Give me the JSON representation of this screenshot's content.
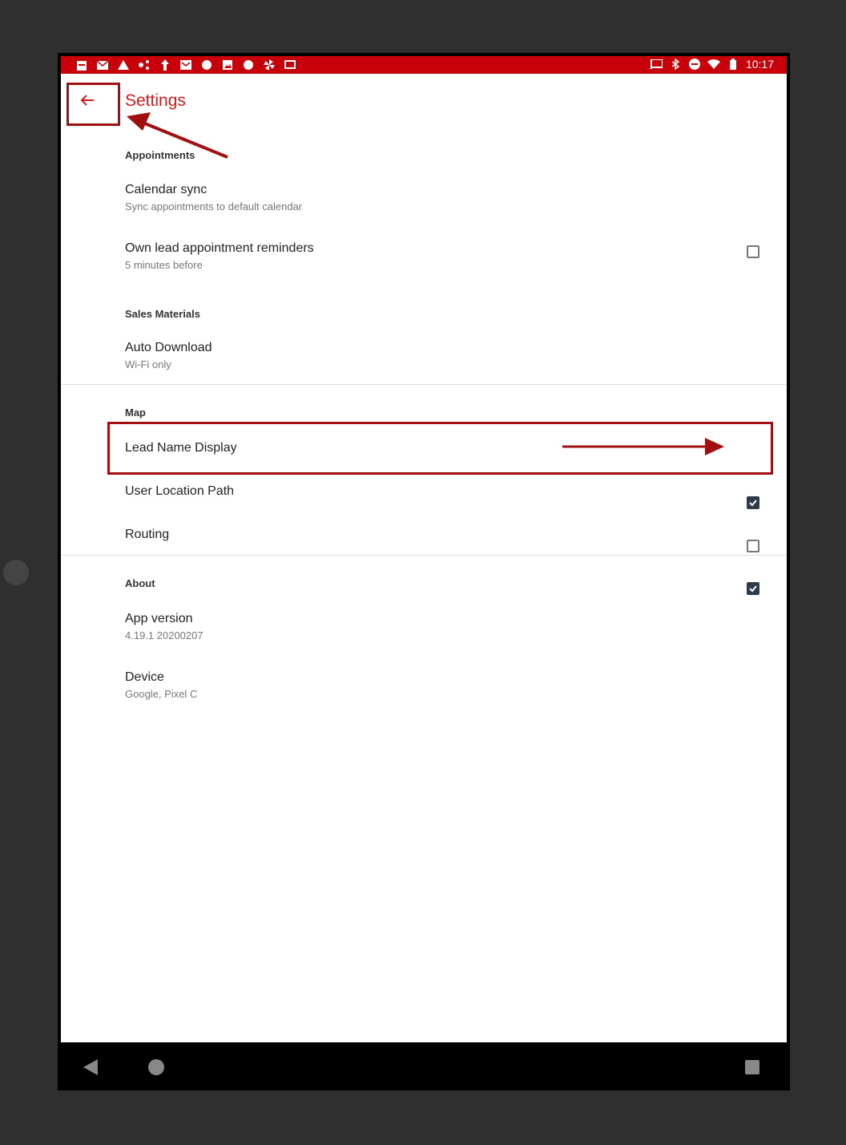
{
  "status_bar": {
    "time": "10:17"
  },
  "header": {
    "title": "Settings",
    "back_icon": "arrow-left-icon"
  },
  "sections": [
    {
      "header": "Appointments",
      "items": [
        {
          "title": "Calendar sync",
          "summary": "Sync appointments to default calendar",
          "checkbox": false
        },
        {
          "title": "Own lead appointment reminders",
          "summary": "5 minutes before"
        }
      ]
    },
    {
      "header": "Sales Materials",
      "items": [
        {
          "title": "Auto Download",
          "summary": "Wi-Fi only"
        }
      ]
    },
    {
      "header": "Map",
      "items": [
        {
          "title": "Lead Name Display",
          "checkbox": true
        },
        {
          "title": "User Location Path",
          "checkbox": false
        },
        {
          "title": "Routing",
          "checkbox": true
        }
      ]
    },
    {
      "header": "About",
      "items": [
        {
          "title": "App version",
          "summary": "4.19.1 20200207"
        },
        {
          "title": "Device",
          "summary": "Google, Pixel C"
        }
      ]
    }
  ],
  "colors": {
    "status_bar": "#c8000a",
    "accent": "#d21a1a",
    "annotation": "#a11010",
    "checkbox_checked": "#2d3a4a"
  }
}
